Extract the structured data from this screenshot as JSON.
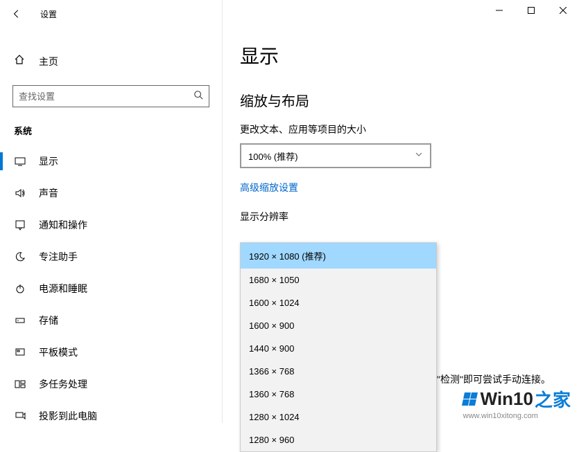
{
  "titlebar": {
    "title": "设置"
  },
  "sidebar": {
    "home_label": "主页",
    "search_placeholder": "查找设置",
    "category": "系统",
    "items": [
      {
        "label": "显示"
      },
      {
        "label": "声音"
      },
      {
        "label": "通知和操作"
      },
      {
        "label": "专注助手"
      },
      {
        "label": "电源和睡眠"
      },
      {
        "label": "存储"
      },
      {
        "label": "平板模式"
      },
      {
        "label": "多任务处理"
      },
      {
        "label": "投影到此电脑"
      }
    ]
  },
  "main": {
    "page_title": "显示",
    "section_scale": "缩放与布局",
    "scale_label": "更改文本、应用等项目的大小",
    "scale_value": "100% (推荐)",
    "adv_link": "高级缩放设置",
    "res_label": "显示分辨率",
    "res_options": [
      "1920 × 1080 (推荐)",
      "1680 × 1050",
      "1600 × 1024",
      "1600 × 900",
      "1440 × 900",
      "1366 × 768",
      "1360 × 768",
      "1280 × 1024",
      "1280 × 960"
    ],
    "detect_hint": "\"检测\"即可尝试手动连接。"
  },
  "watermark": {
    "brand_left": "Win10",
    "brand_right": "之家",
    "url": "www.win10xitong.com"
  }
}
